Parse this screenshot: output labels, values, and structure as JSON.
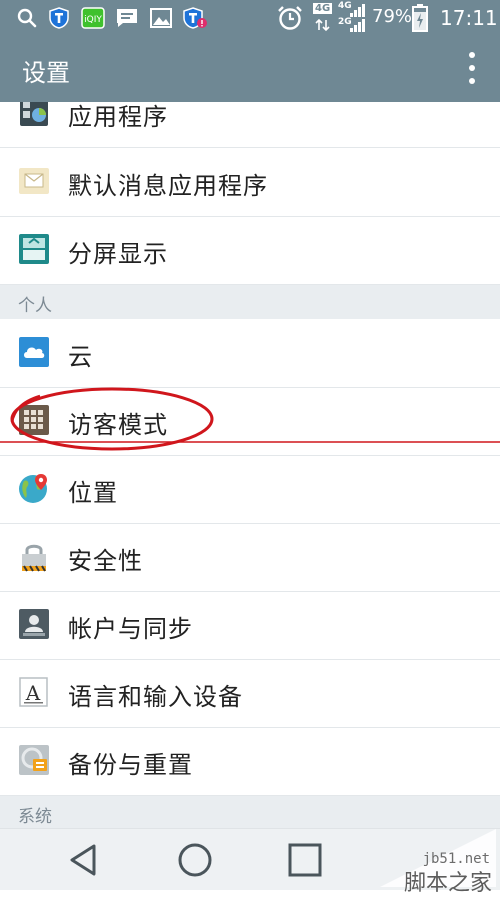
{
  "status_bar": {
    "network": "4G",
    "network2": "4G",
    "network3": "2G",
    "battery": "79%",
    "time": "17:11",
    "icons": [
      "search-icon",
      "shield-icon",
      "iqiyi-icon",
      "message-icon",
      "gallery-icon",
      "shield-alert-icon",
      "alarm-icon",
      "signal-icon",
      "battery-charging-icon"
    ]
  },
  "app_bar": {
    "title": "设置",
    "menu_icon": "overflow-menu-icon"
  },
  "list": {
    "items": [
      {
        "label": "应用程序",
        "icon": "apps-icon"
      },
      {
        "label": "默认消息应用程序",
        "icon": "message-app-icon"
      },
      {
        "label": "分屏显示",
        "icon": "split-screen-icon"
      }
    ],
    "section_personal": "个人",
    "personal_items": [
      {
        "label": "云",
        "icon": "cloud-icon"
      },
      {
        "label": "访客模式",
        "icon": "guest-mode-icon"
      },
      {
        "label": "位置",
        "icon": "location-icon"
      },
      {
        "label": "安全性",
        "icon": "lock-icon"
      },
      {
        "label": "帐户与同步",
        "icon": "account-icon"
      },
      {
        "label": "语言和输入设备",
        "icon": "language-icon"
      },
      {
        "label": "备份与重置",
        "icon": "backup-icon"
      }
    ],
    "section_system": "系统"
  },
  "nav_bar": {
    "back": "back-icon",
    "home": "home-icon",
    "recents": "recents-icon"
  },
  "watermark": {
    "site": "jb51.net",
    "name": "脚本之家"
  },
  "colors": {
    "bar": "#6f8894",
    "highlight_circle": "#d0161c",
    "section_bg": "#e9edf0"
  }
}
